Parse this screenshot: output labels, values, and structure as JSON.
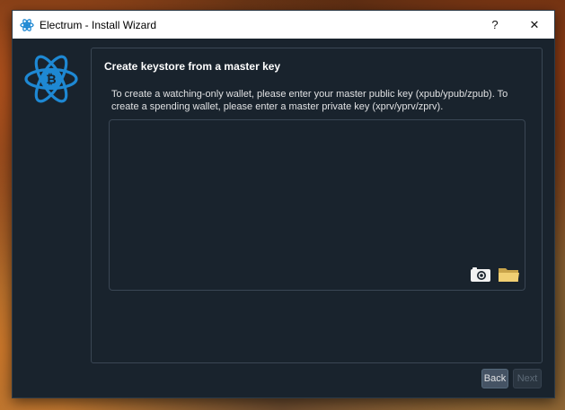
{
  "window": {
    "title": "Electrum  -  Install Wizard",
    "help_button": "?",
    "close_button": "✕"
  },
  "page": {
    "heading": "Create keystore from a master key",
    "description": "To create a watching-only wallet, please enter your master public key (xpub/ypub/zpub). To create a spending wallet, please enter a master private key (xprv/yprv/zprv).",
    "key_value": ""
  },
  "icons": {
    "title_logo": "electrum-logo-icon",
    "main_logo": "electrum-bitcoin-logo-icon",
    "camera": "camera-icon",
    "folder": "folder-icon"
  },
  "buttons": {
    "back": "Back",
    "next": "Next"
  },
  "colors": {
    "window_bg": "#19232d",
    "border": "#3a4654",
    "accent": "#1e88d3",
    "button_bg": "#455364",
    "disabled_text": "#5d6a77"
  }
}
